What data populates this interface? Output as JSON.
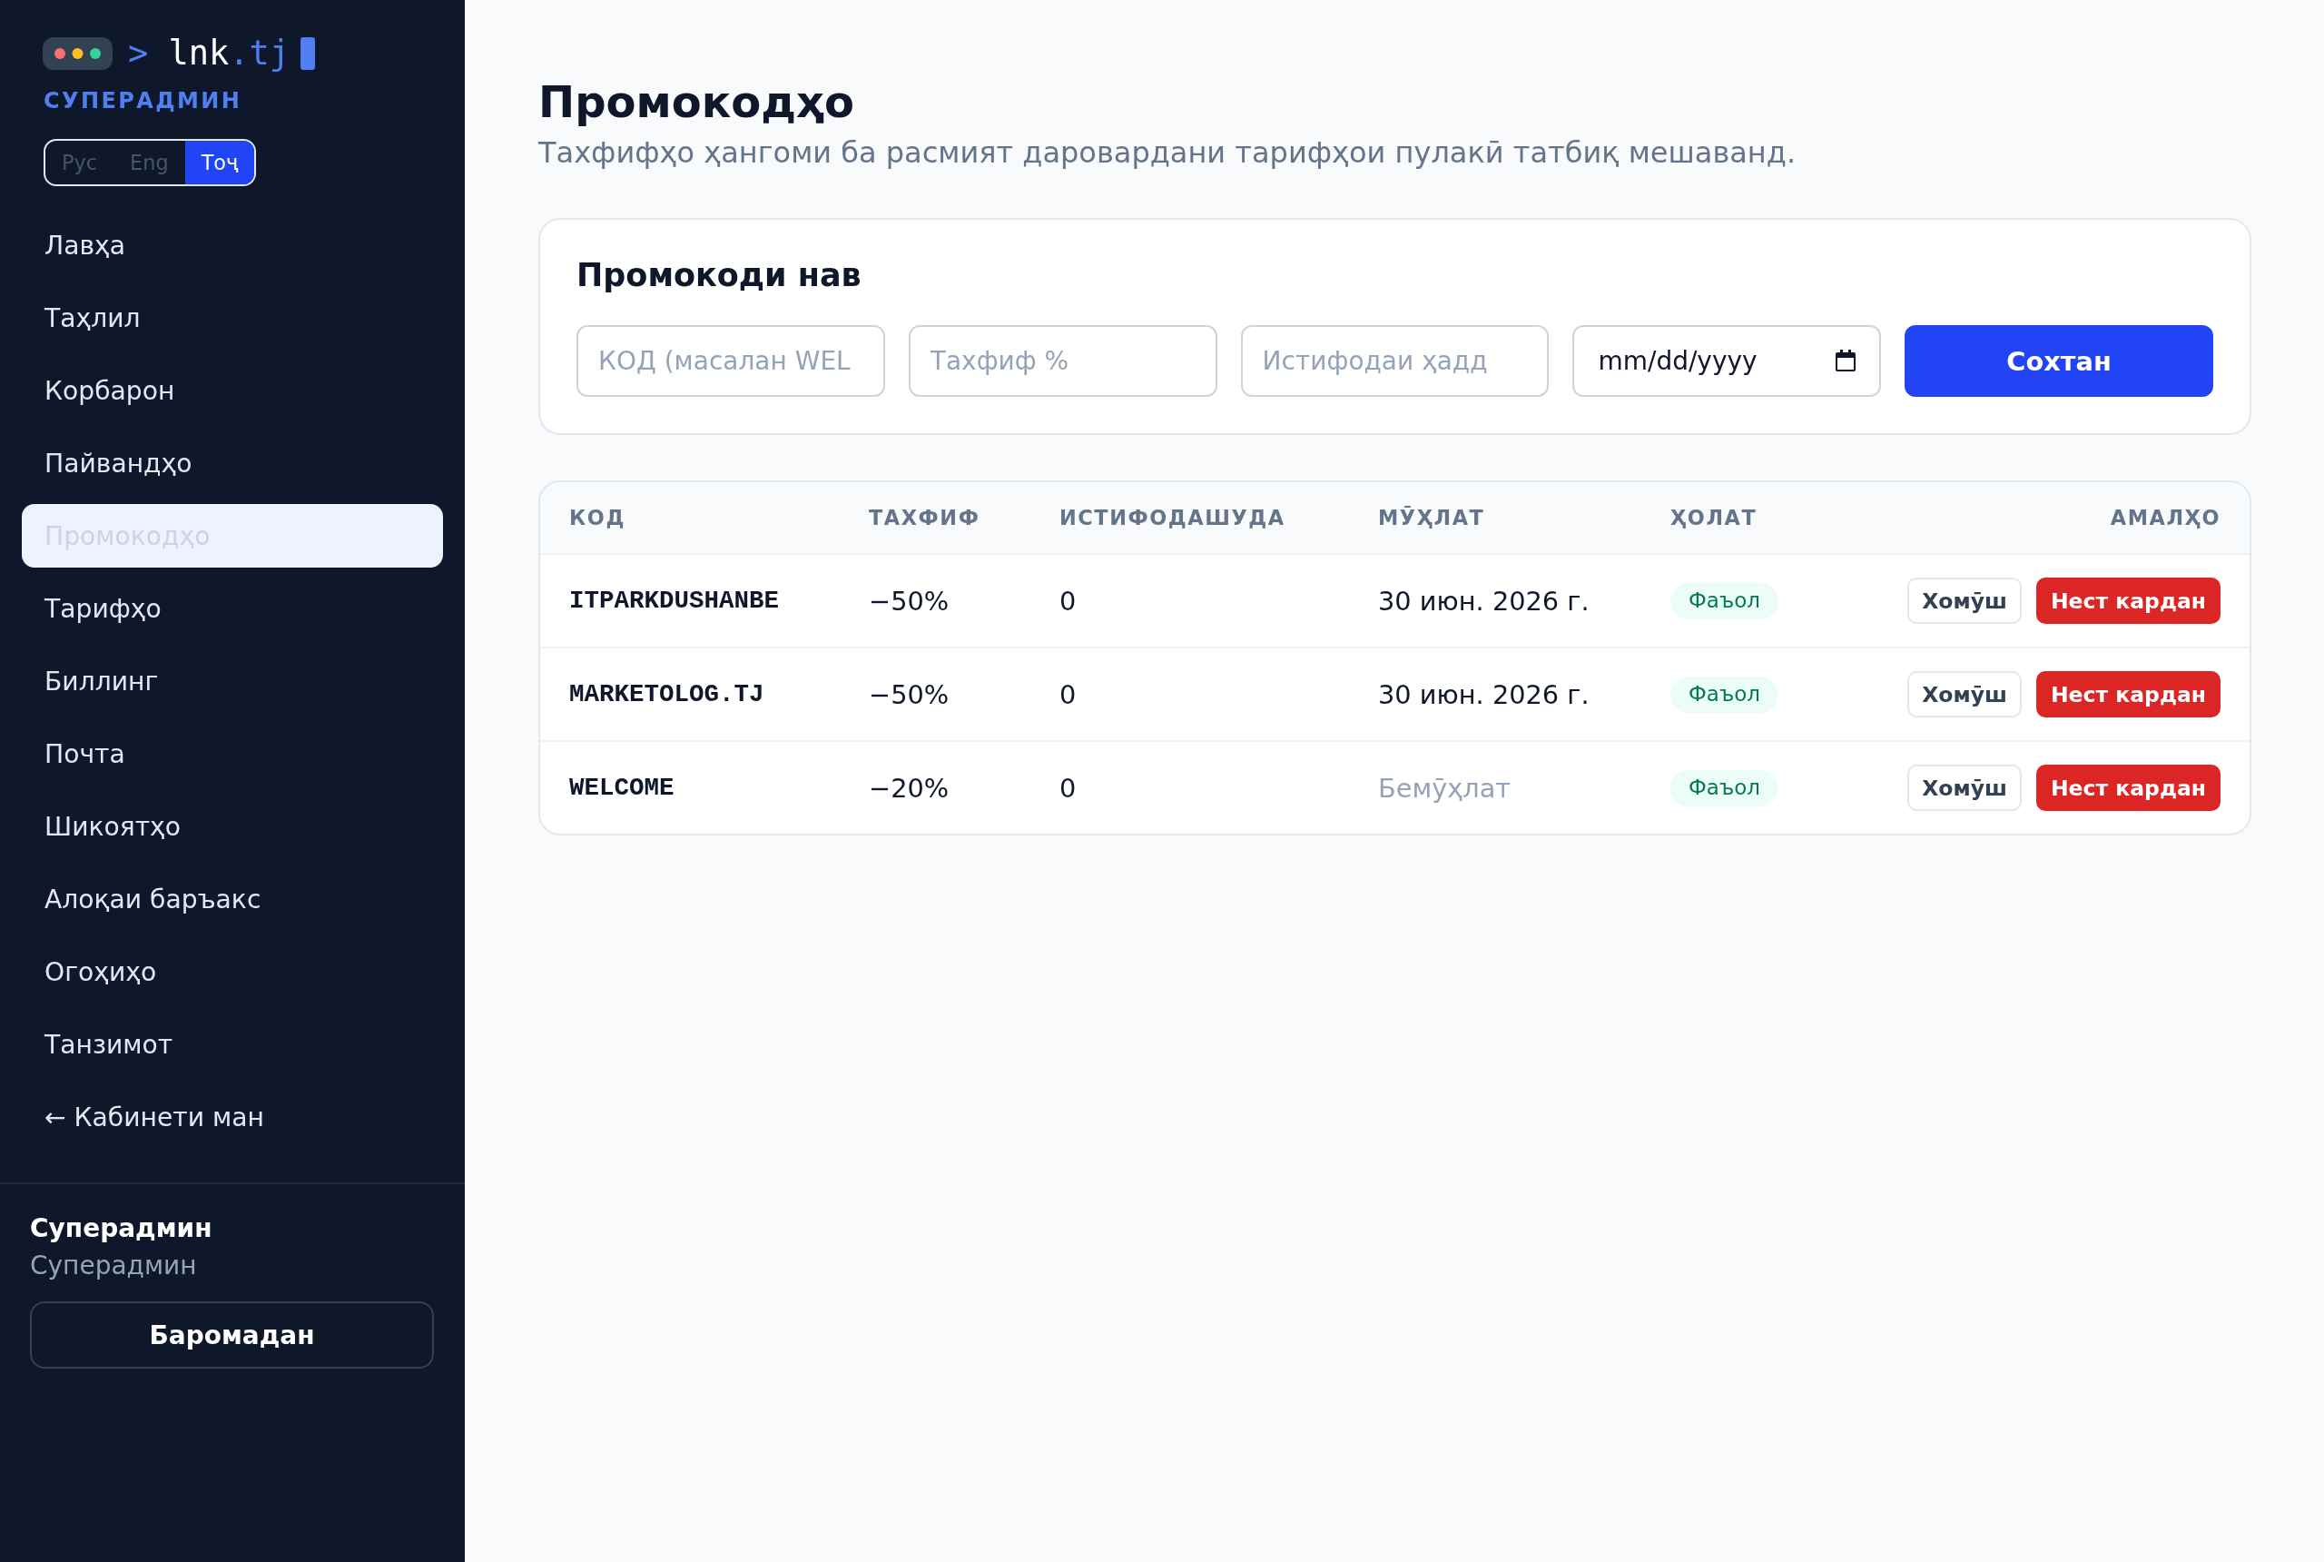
{
  "sidebar": {
    "logo": {
      "prompt": ">",
      "name": "lnk",
      "suffix": ".tj"
    },
    "role_label": "СУПЕРАДМИН",
    "languages": [
      {
        "label": "Рус",
        "selected": false
      },
      {
        "label": "Eng",
        "selected": false
      },
      {
        "label": "Тоҷ",
        "selected": true
      }
    ],
    "nav_items": [
      {
        "label": "Лавҳа",
        "selected": false
      },
      {
        "label": "Таҳлил",
        "selected": false
      },
      {
        "label": "Корбарон",
        "selected": false
      },
      {
        "label": "Пайвандҳо",
        "selected": false
      },
      {
        "label": "Промокодҳо",
        "selected": true
      },
      {
        "label": "Тарифҳо",
        "selected": false
      },
      {
        "label": "Биллинг",
        "selected": false
      },
      {
        "label": "Почта",
        "selected": false
      },
      {
        "label": "Шикоятҳо",
        "selected": false
      },
      {
        "label": "Алоқаи баръакс",
        "selected": false
      },
      {
        "label": "Огоҳиҳо",
        "selected": false
      },
      {
        "label": "Танзимот",
        "selected": false
      },
      {
        "label": "← Кабинети ман",
        "selected": false
      }
    ],
    "user": {
      "name": "Суперадмин",
      "role": "Суперадмин"
    },
    "logout_button": "Баромадан"
  },
  "page": {
    "title": "Промокодҳо",
    "subtitle": "Тахфифҳо ҳангоми ба расмият даровардани тарифҳои пулакӣ татбиқ мешаванд."
  },
  "new_promo": {
    "title": "Промокоди нав",
    "fields": [
      {
        "kind": "text",
        "placeholder": "КОД (масалан WEL"
      },
      {
        "kind": "text",
        "placeholder": "Тахфиф %"
      },
      {
        "kind": "text",
        "placeholder": "Истифодаи ҳадд"
      },
      {
        "kind": "date",
        "placeholder": "mm/dd/yyyy"
      }
    ],
    "submit_button": "Сохтан"
  },
  "table": {
    "columns": [
      "КОД",
      "ТАХФИФ",
      "ИСТИФОДАШУДА",
      "МӮҲЛАТ",
      "ҲОЛАТ",
      "АМАЛҲО"
    ],
    "rows": [
      {
        "code": "ITPARKDUSHANBE",
        "discount": "−50%",
        "used": "0",
        "expiry": "30 июн. 2026 г.",
        "expiry_set": true,
        "status": "Фаъол",
        "actions": [
          {
            "label": "Хомӯш",
            "kind": "disable"
          },
          {
            "label": "Нест кардан",
            "kind": "delete"
          }
        ]
      },
      {
        "code": "MARKETOLOG.TJ",
        "discount": "−50%",
        "used": "0",
        "expiry": "30 июн. 2026 г.",
        "expiry_set": true,
        "status": "Фаъол",
        "actions": [
          {
            "label": "Хомӯш",
            "kind": "disable"
          },
          {
            "label": "Нест кардан",
            "kind": "delete"
          }
        ]
      },
      {
        "code": "WELCOME",
        "discount": "−20%",
        "used": "0",
        "expiry": "Бемӯҳлат",
        "expiry_set": false,
        "status": "Фаъол",
        "actions": [
          {
            "label": "Хомӯш",
            "kind": "disable"
          },
          {
            "label": "Нест кардан",
            "kind": "delete"
          }
        ]
      }
    ]
  }
}
